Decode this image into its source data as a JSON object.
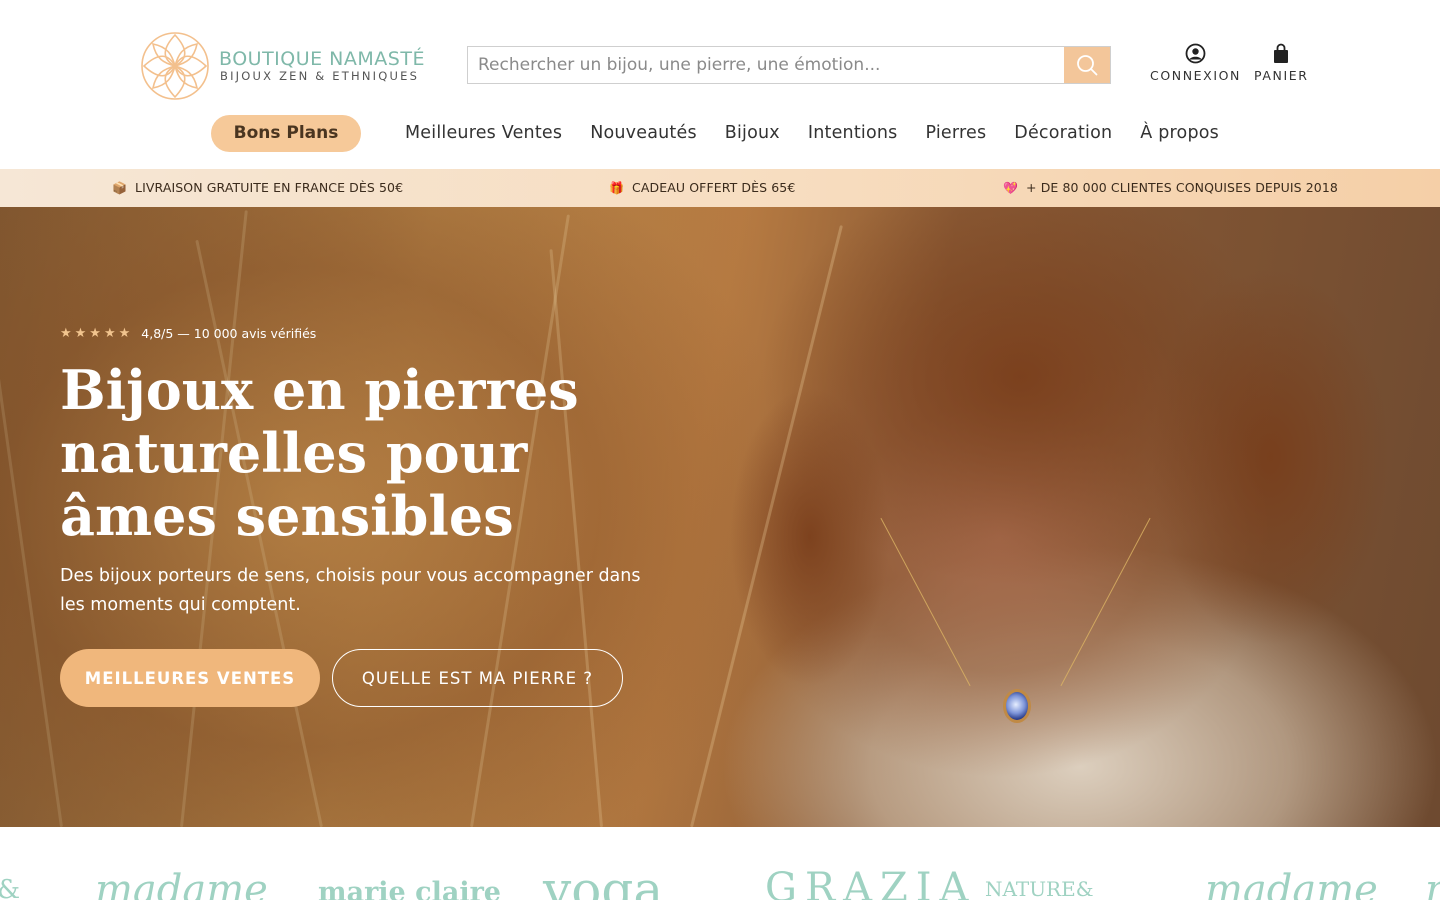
{
  "header": {
    "logo": {
      "name": "BOUTIQUE NAMASTÉ",
      "tagline": "BIJOUX ZEN & ETHNIQUES"
    },
    "search": {
      "placeholder": "Rechercher un bijou, une pierre, une émotion...",
      "icon": "search-icon"
    },
    "account": {
      "login_label": "CONNEXION",
      "login_icon": "user-circle-icon",
      "cart_label": "PANIER",
      "cart_icon": "shopping-bag-icon"
    },
    "nav": {
      "promo": "Bons Plans",
      "items": [
        "Meilleures Ventes",
        "Nouveautés",
        "Bijoux",
        "Intentions",
        "Pierres",
        "Décoration",
        "À propos"
      ]
    }
  },
  "announcement": {
    "items": [
      {
        "icon": "📦",
        "text": "LIVRAISON GRATUITE EN FRANCE DÈS 50€"
      },
      {
        "icon": "🎁",
        "text": "CADEAU OFFERT DÈS 65€"
      },
      {
        "icon": "💖",
        "text": "+ DE 80 000 CLIENTES CONQUISES DEPUIS 2018"
      }
    ]
  },
  "hero": {
    "rating": {
      "stars": "★★★★★",
      "text": "4,8/5 — 10 000 avis vérifiés",
      "value": 4.8
    },
    "title_lines": [
      "Bijoux en pierres",
      "naturelles pour",
      "âmes sensibles"
    ],
    "subtitle": "Des bijoux porteurs de sens, choisis pour vous accompagner dans les moments qui comptent.",
    "primary_cta": "MEILLEURES VENTES",
    "secondary_cta": "QUELLE EST MA PIERRE ?"
  },
  "press": {
    "logos": [
      "E&",
      "madame",
      "marie claire",
      "yoga",
      "GRAZIA",
      "NATURE&",
      "madame",
      "n"
    ]
  },
  "colors": {
    "accent": "#f0b77c",
    "brand_teal": "#7fb8a9",
    "press_logo": "#9fd2c2",
    "announce_bg": "#f7ddc0"
  }
}
